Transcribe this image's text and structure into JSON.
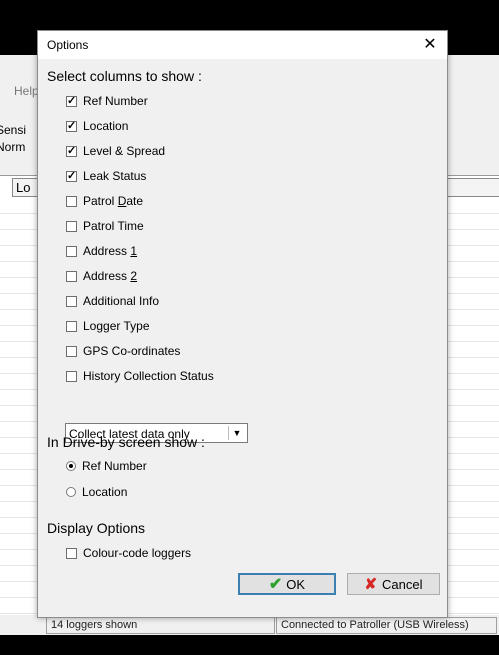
{
  "background_app": {
    "menu_help": "Help",
    "label_sensitivity": "Sensi",
    "label_normal": "Norm",
    "column_header": "Lo",
    "status_left": "14 loggers shown",
    "status_right": "Connected to Patroller (USB Wireless)"
  },
  "dialog": {
    "title": "Options",
    "close_glyph": "✕",
    "section_columns": "Select columns to show :",
    "columns": [
      {
        "label": "Ref Number",
        "checked": true
      },
      {
        "label": "Location",
        "checked": true
      },
      {
        "label": "Level & Spread",
        "checked": true
      },
      {
        "label": "Leak Status",
        "checked": true
      },
      {
        "label_pre": "Patrol ",
        "label_ul": "D",
        "label_post": "ate",
        "checked": false
      },
      {
        "label": "Patrol Time",
        "checked": false
      },
      {
        "label_pre": "Address ",
        "label_ul": "1",
        "label_post": "",
        "checked": false
      },
      {
        "label_pre": "Address ",
        "label_ul": "2",
        "label_post": "",
        "checked": false
      },
      {
        "label": "Additional Info",
        "checked": false
      },
      {
        "label": "Logger Type",
        "checked": false
      },
      {
        "label": "GPS Co-ordinates",
        "checked": false
      },
      {
        "label": "History Collection Status",
        "checked": false
      }
    ],
    "history_select_value": "Collect latest data only",
    "section_driveby": "In Drive-by screen show :",
    "driveby_options": [
      {
        "label": "Ref Number",
        "selected": true
      },
      {
        "label": "Location",
        "selected": false
      }
    ],
    "section_display": "Display Options",
    "display_colour_code": {
      "label": "Colour-code loggers",
      "checked": false
    },
    "ok_label": "OK",
    "cancel_label": "Cancel"
  },
  "colors": {
    "ok_icon": "#2ea02e",
    "cancel_icon": "#d62626",
    "dialog_body": "#f0f0f0"
  }
}
